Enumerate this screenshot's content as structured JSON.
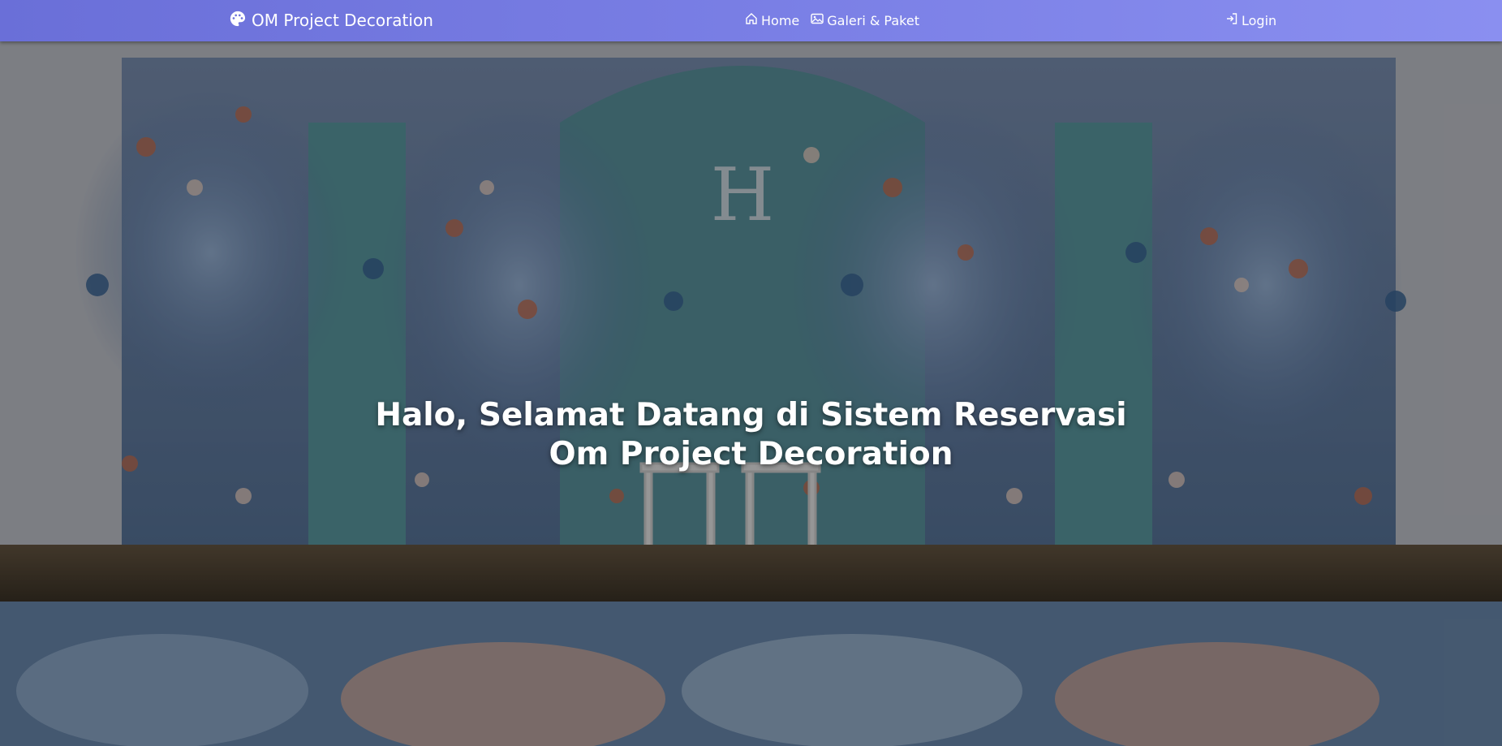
{
  "navbar": {
    "brand": {
      "icon": "palette-icon",
      "label": "OM Project Decoration"
    },
    "links": [
      {
        "icon": "home-icon",
        "label": "Home"
      },
      {
        "icon": "image-icon",
        "label": "Galeri & Paket"
      }
    ],
    "login": {
      "icon": "login-icon",
      "label": "Login"
    }
  },
  "hero": {
    "title_line1": "Halo, Selamat Datang di Sistem Reservasi",
    "title_line2": "Om Project Decoration"
  },
  "colors": {
    "navbar_start": "#6a6fd8",
    "navbar_end": "#8a8ff0",
    "text": "#ffffff"
  }
}
